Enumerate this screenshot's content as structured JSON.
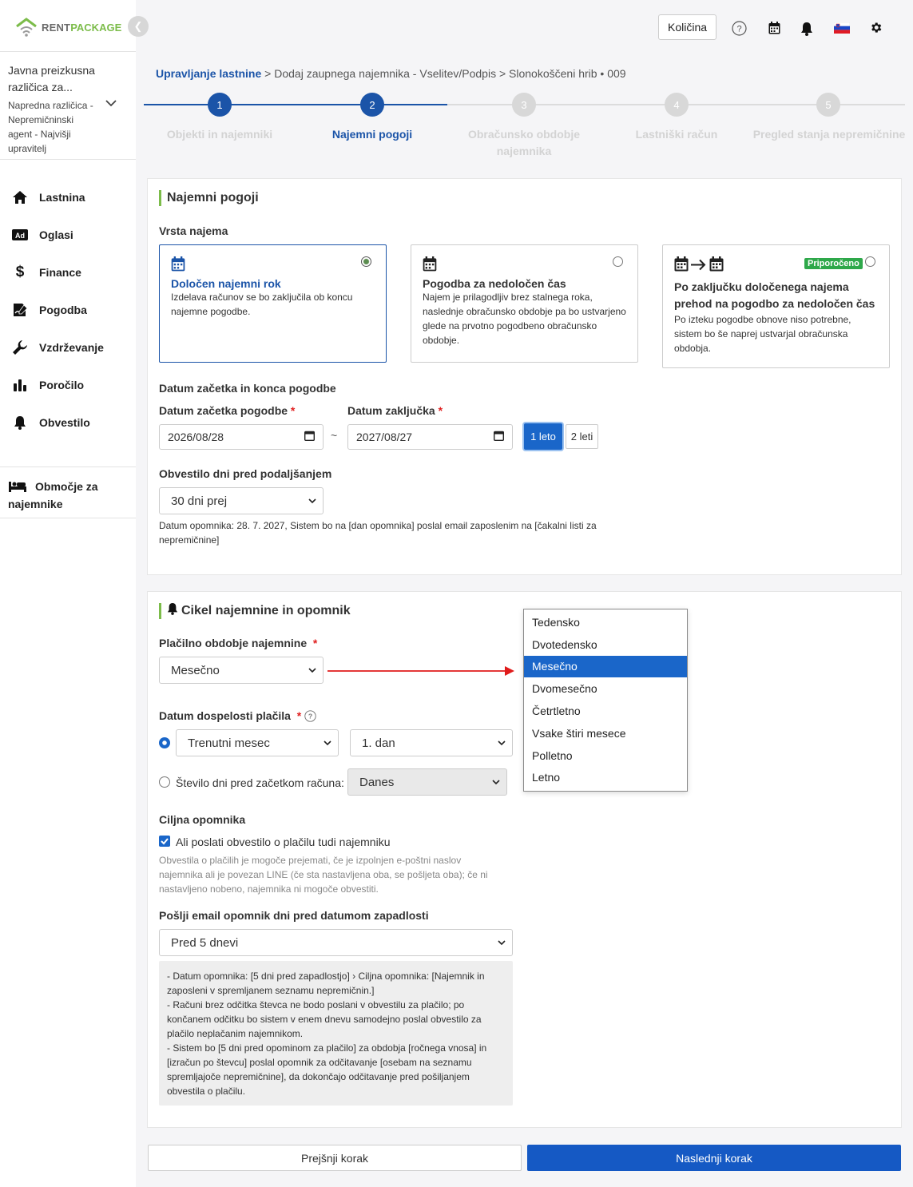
{
  "app": {
    "logo_a": "RENT",
    "logo_b": "PACKAGE",
    "brand_color": "#7cbc4a",
    "accent": "#1a66c9"
  },
  "account": {
    "line1": "Javna preizkusna različica za...",
    "line2": "Napredna različica - Nepremičninski agent - Najvišji upravitelj"
  },
  "topbar": {
    "quantity_label": "Količina",
    "icons": [
      "help-icon",
      "calendar-icon",
      "bell-icon",
      "flag-si-icon",
      "gear-icon"
    ]
  },
  "sidebar": {
    "items": [
      {
        "label": "Lastnina",
        "icon": "home-icon"
      },
      {
        "label": "Oglasi",
        "icon": "ad-icon"
      },
      {
        "label": "Finance",
        "icon": "dollar-icon"
      },
      {
        "label": "Pogodba",
        "icon": "contract-icon"
      },
      {
        "label": "Vzdrževanje",
        "icon": "wrench-icon"
      },
      {
        "label": "Poročilo",
        "icon": "chart-icon"
      },
      {
        "label": "Obvestilo",
        "icon": "bell-icon"
      }
    ],
    "tenant_area": "Območje za najemnike"
  },
  "breadcrumb": {
    "root": "Upravljanje lastnine",
    "rest": " > Dodaj zaupnega najemnika - Vselitev/Podpis > Slonokoščeni hrib • 009"
  },
  "steps": [
    {
      "num": "1",
      "label": "Objekti in najemniki",
      "state": "done"
    },
    {
      "num": "2",
      "label": "Najemni pogoji",
      "state": "active"
    },
    {
      "num": "3",
      "label": "Obračunsko obdobje najemnika",
      "state": "todo"
    },
    {
      "num": "4",
      "label": "Lastniški račun",
      "state": "todo"
    },
    {
      "num": "5",
      "label": "Pregled stanja nepremičnine",
      "state": "todo"
    }
  ],
  "terms": {
    "title": "Najemni pogoji",
    "type_label": "Vrsta najema",
    "options": [
      {
        "title": "Določen najemni rok",
        "desc": "Izdelava računov se bo zaključila ob koncu najemne pogodbe.",
        "selected": true
      },
      {
        "title": "Pogodba za nedoločen čas",
        "desc": "Najem je prilagodljiv brez stalnega roka, naslednje obračunsko obdobje pa bo ustvarjeno glede na prvotno pogodbeno obračunsko obdobje.",
        "selected": false
      },
      {
        "title": "Po zaključku določenega najema prehod na pogodbo za nedoločen čas",
        "desc": "Po izteku pogodbe obnove niso potrebne, sistem bo še naprej ustvarjal obračunska obdobja.",
        "badge": "Priporočeno",
        "selected": false
      }
    ],
    "dates_heading": "Datum začetka in konca pogodbe",
    "start_label": "Datum začetka pogodbe",
    "end_label": "Datum zaključka",
    "start_value": "2026/08/28",
    "end_value": "2027/08/27",
    "tilde": "~",
    "year1": "1 leto",
    "year2": "2 leti",
    "notice_label": "Obvestilo dni pred podaljšanjem",
    "notice_value": "30 dni prej",
    "notice_note": "Datum opomnika: 28. 7. 2027, Sistem bo na [dan opomnika] poslal email zaposlenim na [čakalni listi za nepremičnine]"
  },
  "cycle": {
    "title": "Cikel najemnine in opomnik",
    "period_label": "Plačilno obdobje najemnine",
    "period_value": "Mesečno",
    "period_options": [
      "Tedensko",
      "Dvotedensko",
      "Mesečno",
      "Dvomesečno",
      "Četrtletno",
      "Vsake štiri mesece",
      "Polletno",
      "Letno"
    ],
    "period_selected_index": 2,
    "due_label": "Datum dospelosti plačila",
    "due_month": "Trenutni mesec",
    "due_day": "1. dan",
    "days_before_label": "Število dni pred začetkom računa:",
    "days_before_value": "Danes",
    "target_label": "Ciljna opomnika",
    "send_tenant_label": "Ali poslati obvestilo o plačilu tudi najemniku",
    "send_tenant_note": "Obvestila o plačilih je mogoče prejemati, če je izpolnjen e-poštni naslov najemnika ali je povezan LINE (če sta nastavljena oba, se pošljeta oba); če ni nastavljeno nobeno, najemnika ni mogoče obvestiti.",
    "email_days_label": "Pošlji email opomnik dni pred datumom zapadlosti",
    "email_days_value": "Pred 5 dnevi",
    "info": [
      "- Datum opomnika: [5 dni pred zapadlostjo] › Ciljna opomnika: [Najemnik in zaposleni v spremljanem seznamu nepremičnin.]",
      "- Računi brez odčitka števca ne bodo poslani v obvestilu za plačilo; po končanem odčitku bo sistem v enem dnevu samodejno poslal obvestilo za plačilo neplačanim najemnikom.",
      "- Sistem bo [5 dni pred opominom za plačilo] za obdobja [ročnega vnosa] in [izračun po števcu] poslal opomnik za odčitavanje [osebam na seznamu spremljajoče nepremičnine], da dokončajo odčitavanje pred pošiljanjem obvestila o plačilu."
    ]
  },
  "footer": {
    "prev": "Prejšnji korak",
    "next": "Naslednji korak"
  }
}
